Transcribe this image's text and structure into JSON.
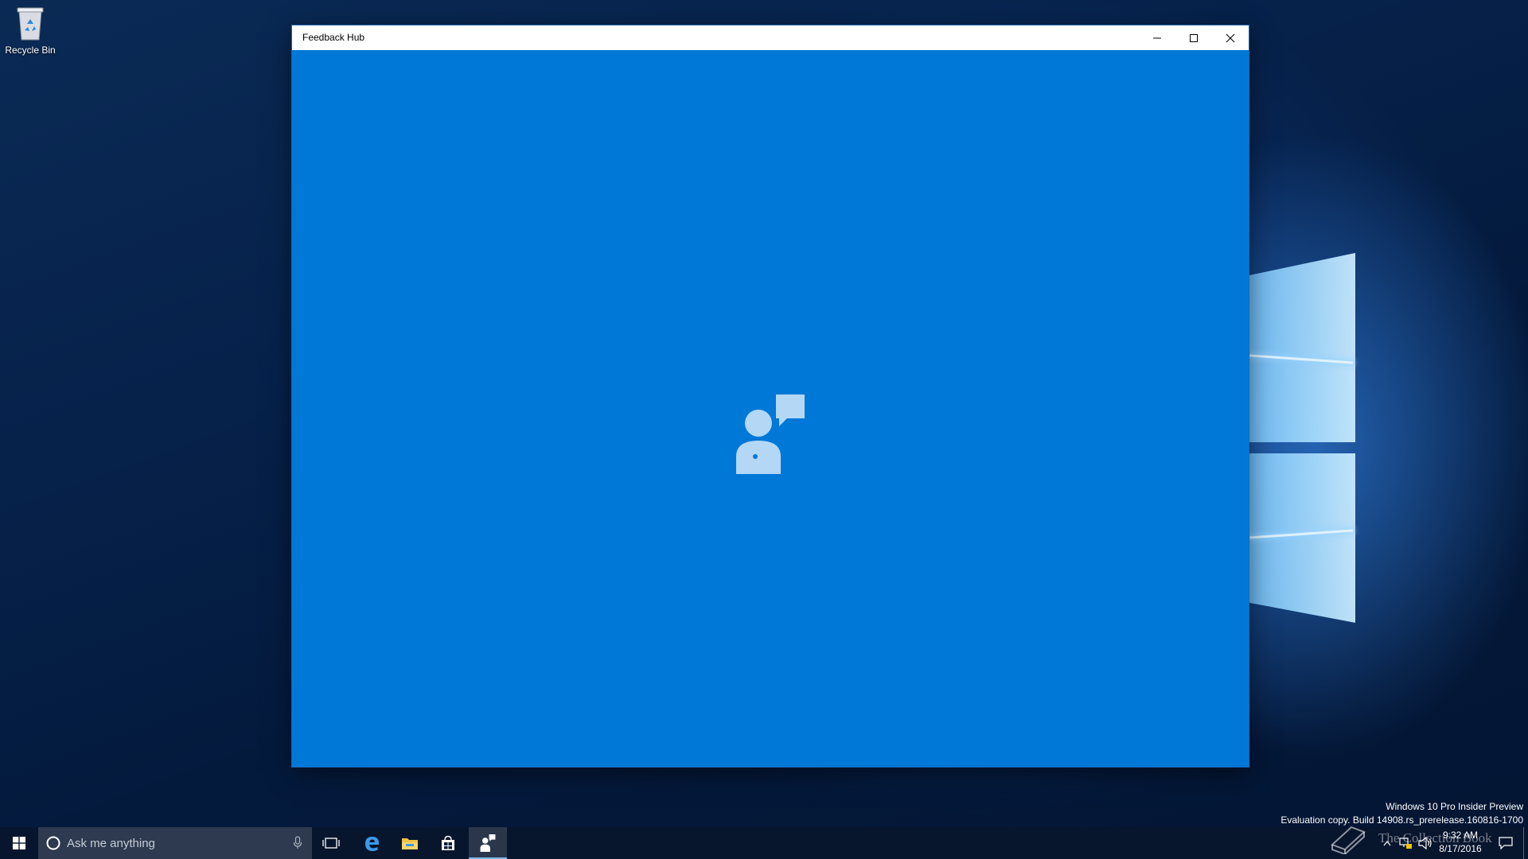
{
  "desktop": {
    "icons": [
      {
        "label": "Recycle Bin",
        "icon": "recycle-bin-icon"
      }
    ],
    "watermark": {
      "line1": "Windows 10 Pro Insider Preview",
      "line2": "Evaluation copy. Build 14908.rs_prerelease.160816-1700"
    },
    "overlay_text": "The Collection Book"
  },
  "window": {
    "title": "Feedback Hub",
    "buttons": {
      "minimize": "minimize-icon",
      "maximize": "maximize-icon",
      "close": "close-icon"
    },
    "splash_icon": "feedback-hub-icon",
    "background_color": "#0078d7"
  },
  "taskbar": {
    "search": {
      "placeholder": "Ask me anything"
    },
    "pinned": [
      {
        "name": "task-view",
        "icon": "task-view-icon"
      },
      {
        "name": "microsoft-edge",
        "icon": "edge-icon"
      },
      {
        "name": "file-explorer",
        "icon": "folder-icon"
      },
      {
        "name": "store",
        "icon": "store-icon"
      },
      {
        "name": "feedback-hub",
        "icon": "feedback-hub-icon",
        "active": true
      }
    ],
    "tray": {
      "time": "9:32 AM",
      "date": "8/17/2016"
    },
    "accent_color": "#76b9ed"
  }
}
